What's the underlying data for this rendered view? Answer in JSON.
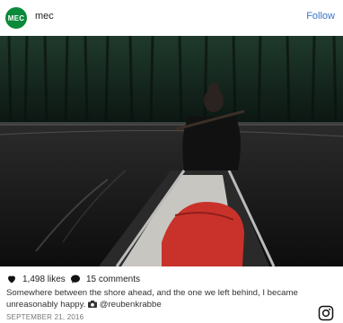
{
  "header": {
    "avatar_text": "MEC",
    "username": "mec",
    "follow_label": "Follow"
  },
  "stats": {
    "likes": "1,498 likes",
    "comments": "15 comments"
  },
  "caption": {
    "text": "Somewhere between the shore ahead, and the one we left behind, I became unreasonably happy.",
    "credit": "@reubenkrabbe"
  },
  "date": "SEPTEMBER 21, 2016",
  "colors": {
    "brand_green": "#0a8a3a",
    "follow_blue": "#3a74c9"
  },
  "icons": [
    "heart-icon",
    "comment-icon",
    "camera-icon",
    "instagram-icon"
  ]
}
